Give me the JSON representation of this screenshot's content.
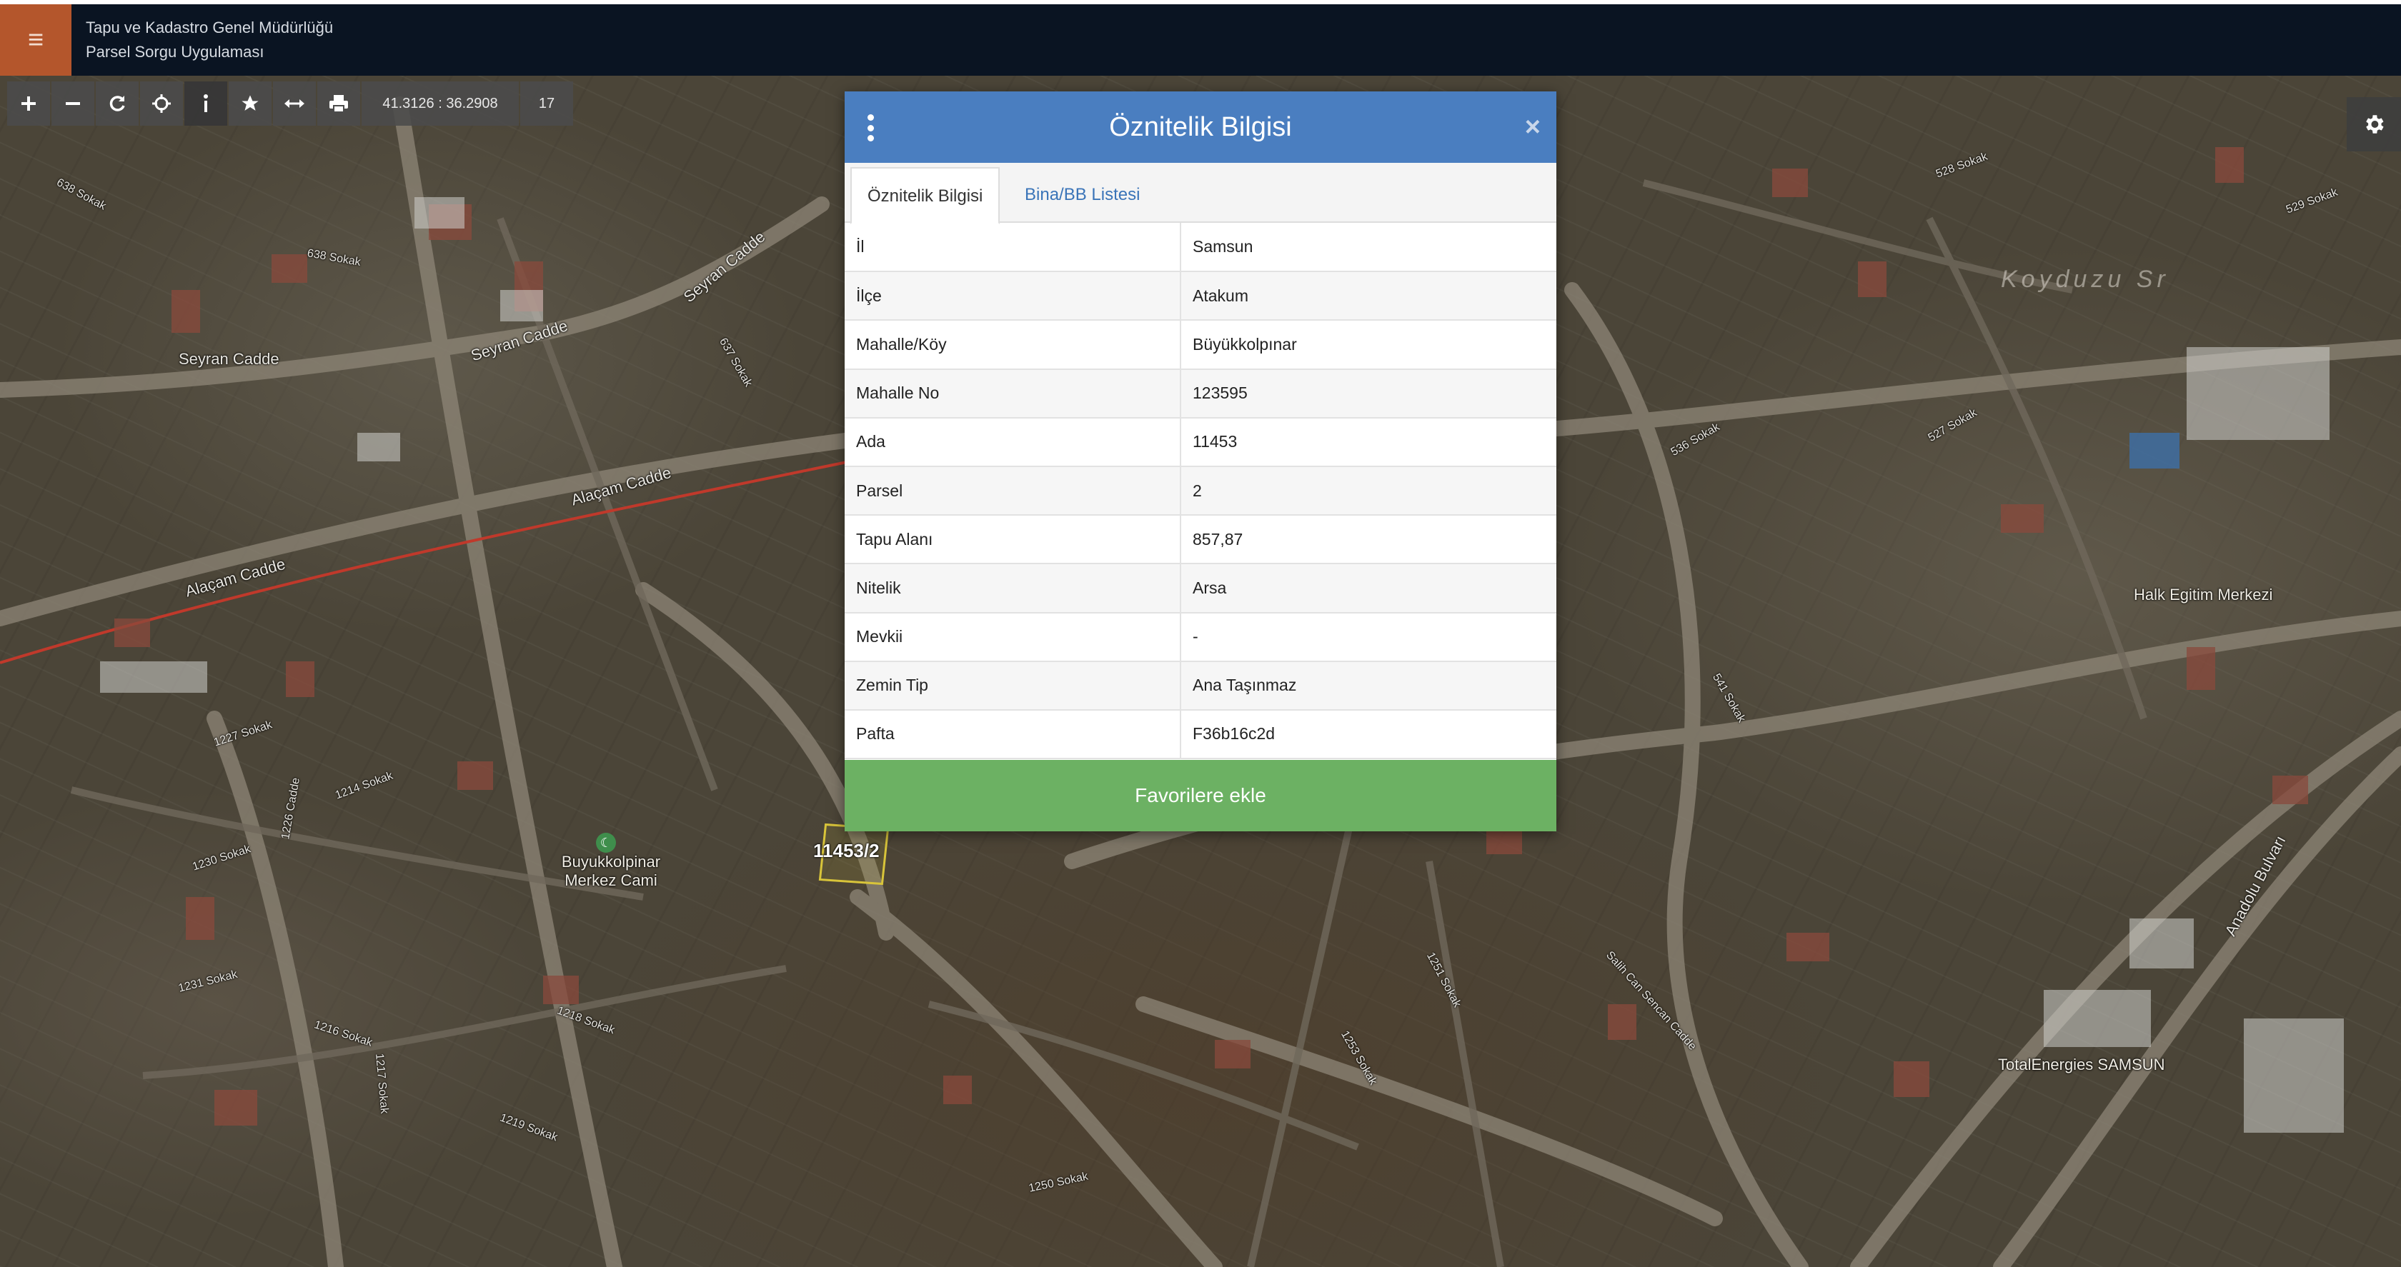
{
  "header": {
    "menu_icon": "hamburger-icon",
    "org_name": "Tapu ve Kadastro Genel Müdürlüğü",
    "app_name": "Parsel Sorgu Uygulaması"
  },
  "toolbar": {
    "tools": [
      {
        "name": "zoom-in",
        "icon": "plus-icon"
      },
      {
        "name": "zoom-out",
        "icon": "minus-icon"
      },
      {
        "name": "refresh",
        "icon": "refresh-icon"
      },
      {
        "name": "locate",
        "icon": "crosshair-icon"
      },
      {
        "name": "info",
        "icon": "info-icon"
      },
      {
        "name": "favorites",
        "icon": "star-icon"
      },
      {
        "name": "measure",
        "icon": "measure-icon"
      },
      {
        "name": "print",
        "icon": "print-icon"
      }
    ],
    "coordinates": "41.3126 : 36.2908",
    "zoom": "17"
  },
  "map": {
    "parcel_label": "11453/2",
    "area_labels": [
      "Koyduzu Sr"
    ],
    "poi_labels": [
      {
        "text": "Buyukkolpinar Merkez Cami"
      },
      {
        "text": "Halk Egitim Merkezi"
      },
      {
        "text": "TotalEnergies SAMSUN"
      }
    ],
    "street_labels": [
      "Seyran Cadde",
      "Seyran Cadde",
      "Seyran Cadde",
      "Alaçam Cadde",
      "Alaçam Cadde",
      "638 Sokak",
      "638 Sokak",
      "637 Sokak",
      "1214 Sokak",
      "1227 Sokak",
      "1226 Cadde",
      "1230 Sokak",
      "1231 Sokak",
      "1216 Sokak",
      "1218 Sokak",
      "1217 Sokak",
      "1219 Sokak",
      "1250 Sokak",
      "1253 Sokak",
      "1251 Sokak",
      "Salih Can Sencan Cadde",
      "541 Sokak",
      "527 Sokak",
      "528 Sokak",
      "536 Sokak",
      "529 Sokak",
      "Anadolu Bulvarı"
    ]
  },
  "panel": {
    "title": "Öznitelik Bilgisi",
    "menu_icon": "kebab-menu-icon",
    "close_label": "×",
    "tabs": [
      {
        "label": "Öznitelik Bilgisi",
        "active": true
      },
      {
        "label": "Bina/BB Listesi",
        "active": false
      }
    ],
    "rows": [
      {
        "key": "İl",
        "value": "Samsun"
      },
      {
        "key": "İlçe",
        "value": "Atakum"
      },
      {
        "key": "Mahalle/Köy",
        "value": "Büyükkolpınar"
      },
      {
        "key": "Mahalle No",
        "value": "123595"
      },
      {
        "key": "Ada",
        "value": "11453"
      },
      {
        "key": "Parsel",
        "value": "2"
      },
      {
        "key": "Tapu Alanı",
        "value": "857,87"
      },
      {
        "key": "Nitelik",
        "value": "Arsa"
      },
      {
        "key": "Mevkii",
        "value": "-"
      },
      {
        "key": "Zemin Tip",
        "value": "Ana Taşınmaz"
      },
      {
        "key": "Pafta",
        "value": "F36b16c2d"
      }
    ],
    "favorite_button": "Favorilere ekle"
  },
  "settings": {
    "icon": "gear-icon"
  },
  "colors": {
    "header_bg": "#0a1422",
    "menu_accent": "#b4562c",
    "panel_header": "#4a7ec0",
    "favorite_green": "#6cb163",
    "tab_link": "#3a74b8"
  }
}
